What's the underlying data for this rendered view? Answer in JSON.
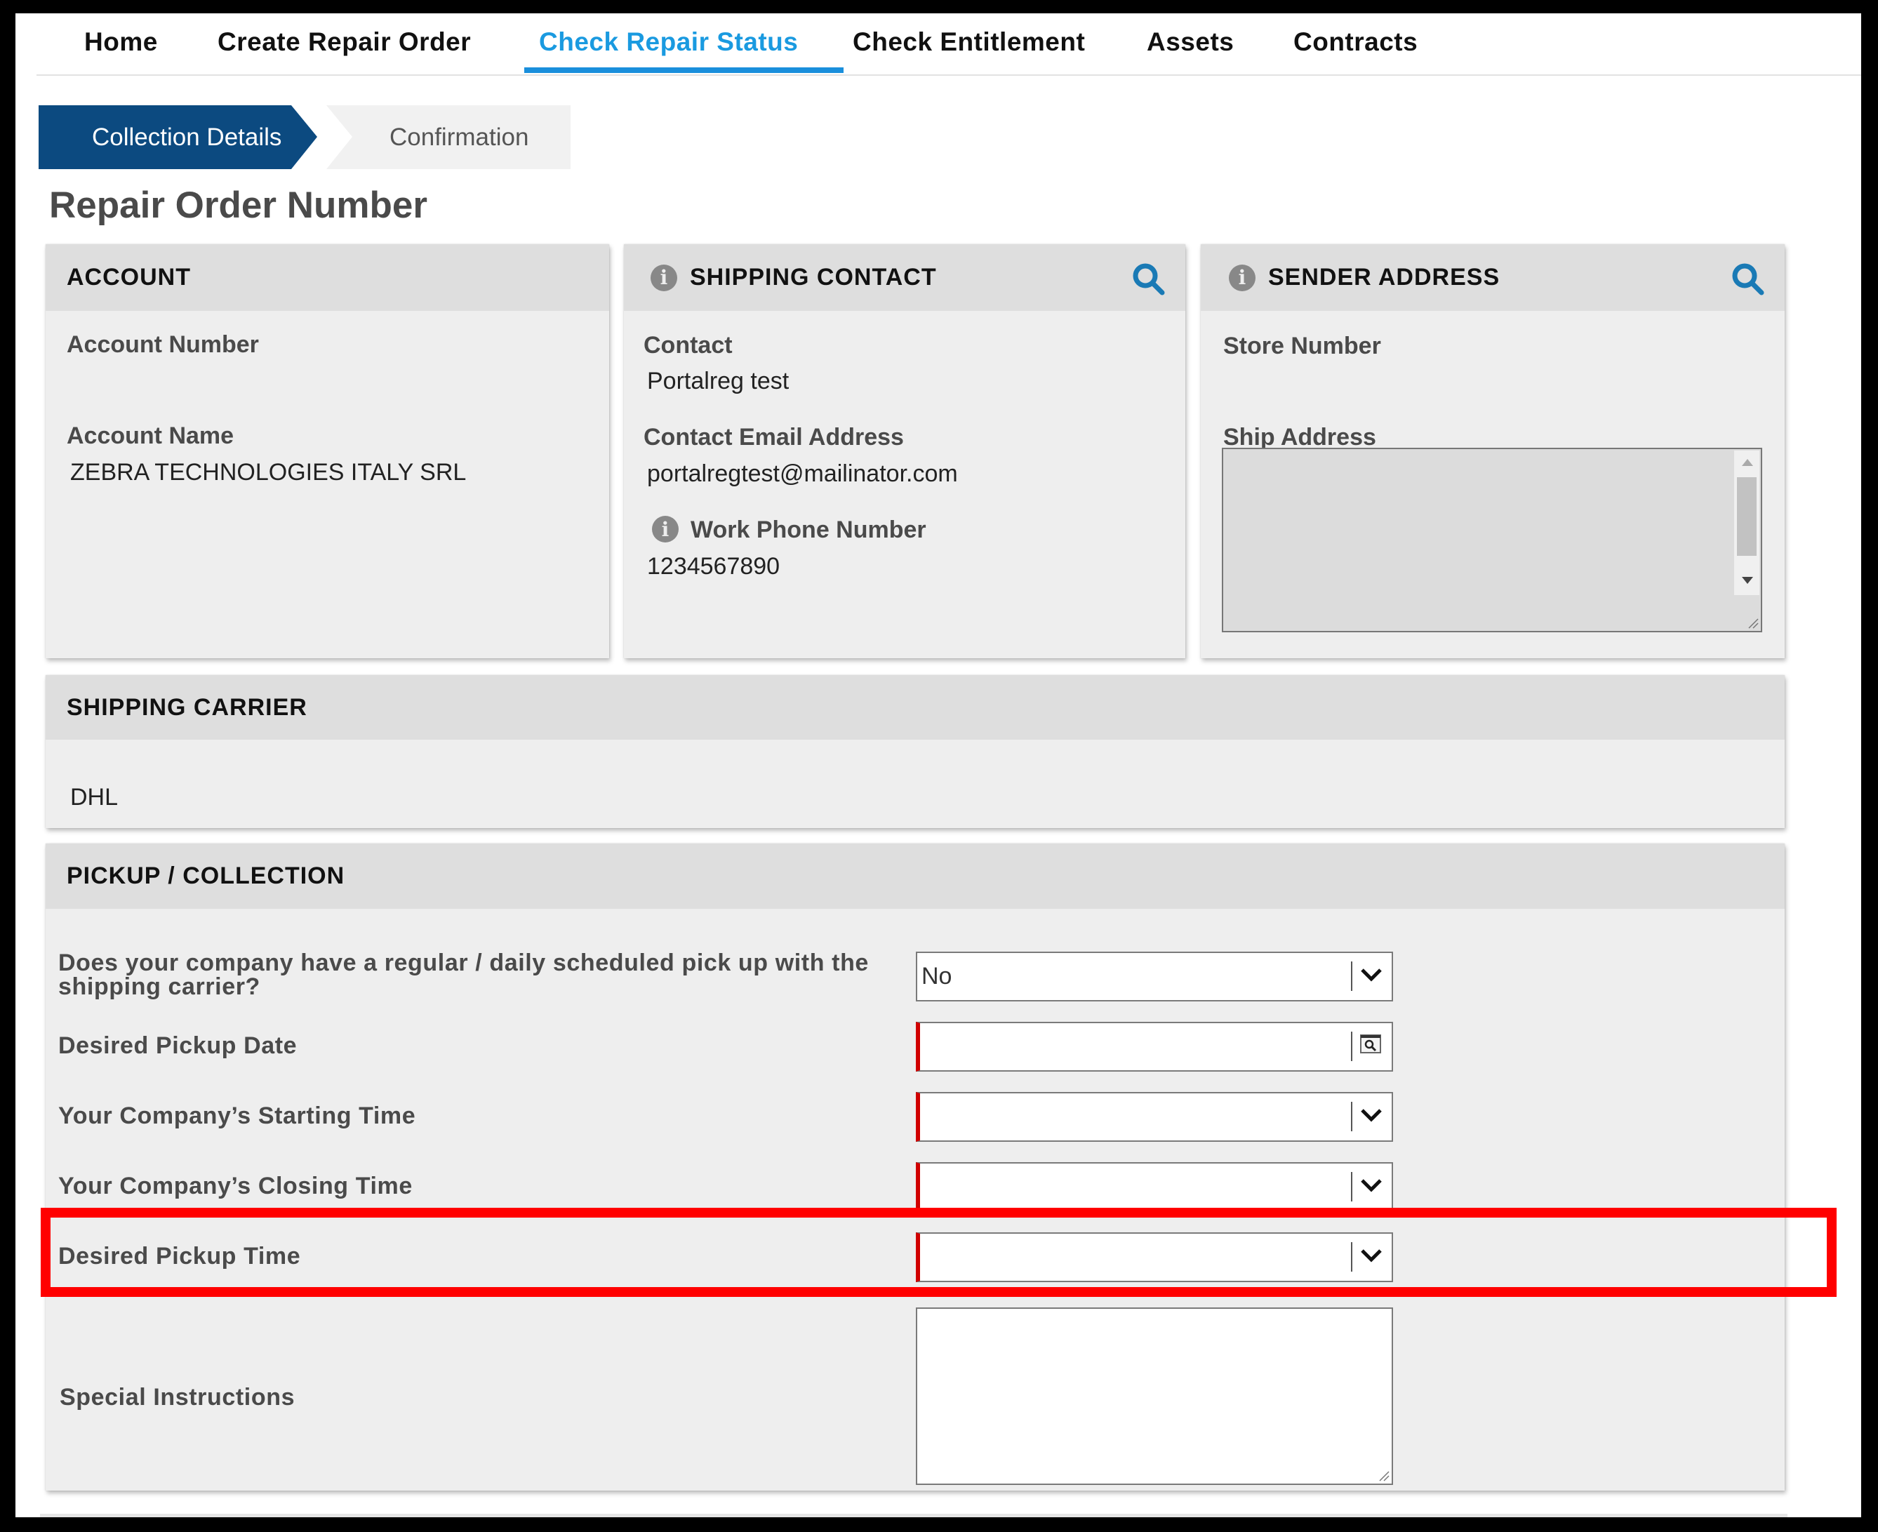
{
  "nav": {
    "items": [
      {
        "label": "Home"
      },
      {
        "label": "Create Repair Order"
      },
      {
        "label": "Check Repair Status",
        "active": true
      },
      {
        "label": "Check Entitlement"
      },
      {
        "label": "Assets"
      },
      {
        "label": "Contracts"
      }
    ]
  },
  "steps": {
    "current": "Collection Details",
    "next": "Confirmation"
  },
  "page_title": "Repair Order Number",
  "account": {
    "title": "ACCOUNT",
    "account_number_label": "Account Number",
    "account_number_value": "",
    "account_name_label": "Account Name",
    "account_name_value": "ZEBRA TECHNOLOGIES ITALY SRL"
  },
  "shipping_contact": {
    "title": "SHIPPING CONTACT",
    "contact_label": "Contact",
    "contact_value": "Portalreg test",
    "email_label": "Contact Email Address",
    "email_value": "portalregtest@mailinator.com",
    "phone_label": "Work Phone Number",
    "phone_value": "1234567890"
  },
  "sender_address": {
    "title": "SENDER ADDRESS",
    "store_number_label": "Store Number",
    "store_number_value": "",
    "ship_address_label": "Ship Address",
    "ship_address_value": ""
  },
  "shipping_carrier": {
    "title": "SHIPPING CARRIER",
    "value": "DHL"
  },
  "pickup": {
    "title": "PICKUP / COLLECTION",
    "regular_pickup_label": "Does your company have a regular / daily scheduled pick up with the shipping carrier?",
    "regular_pickup_value": "No",
    "pickup_date_label": "Desired Pickup Date",
    "pickup_date_value": "",
    "start_time_label": "Your Company’s Starting Time",
    "start_time_value": "",
    "closing_time_label": "Your Company’s Closing Time",
    "closing_time_value": "",
    "pickup_time_label": "Desired Pickup Time",
    "pickup_time_value": "",
    "instructions_label": "Special Instructions",
    "instructions_value": ""
  },
  "colors": {
    "accent": "#1a9ae0",
    "step_active": "#0c4a80",
    "required": "#d00000",
    "highlight": "#ff0000",
    "search_icon": "#1a7ab5"
  }
}
